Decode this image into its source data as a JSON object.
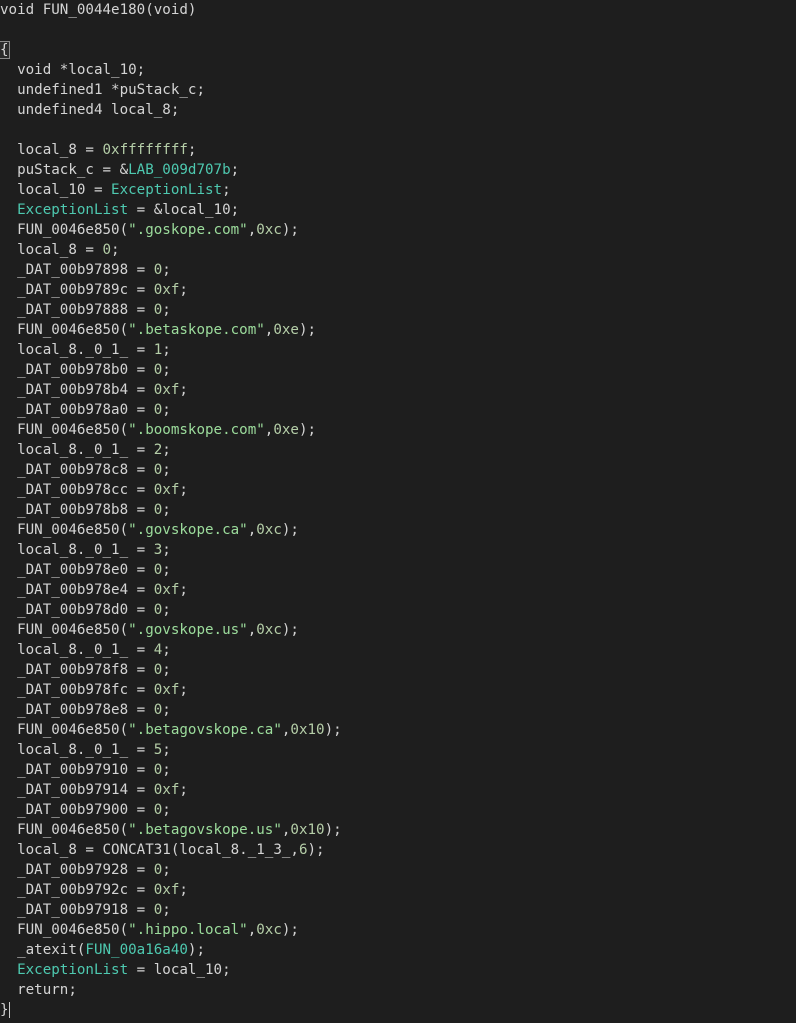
{
  "signature": "void FUN_0044e180(void)",
  "lines": [
    [
      [
        "fn",
        "void FUN_0044e180(void)"
      ]
    ],
    [],
    [
      [
        "cursor-brace",
        "{"
      ]
    ],
    [
      [
        "txt",
        "  void *local_10;"
      ]
    ],
    [
      [
        "txt",
        "  undefined1 *puStack_c;"
      ]
    ],
    [
      [
        "txt",
        "  undefined4 local_8;"
      ]
    ],
    [],
    [
      [
        "txt",
        "  local_8 = "
      ],
      [
        "num",
        "0xffffffff"
      ],
      [
        "txt",
        ";"
      ]
    ],
    [
      [
        "txt",
        "  puStack_c = &"
      ],
      [
        "lab",
        "LAB_009d707b"
      ],
      [
        "txt",
        ";"
      ]
    ],
    [
      [
        "txt",
        "  local_10 = "
      ],
      [
        "glob",
        "ExceptionList"
      ],
      [
        "txt",
        ";"
      ]
    ],
    [
      [
        "txt",
        "  "
      ],
      [
        "glob",
        "ExceptionList"
      ],
      [
        "txt",
        " = &local_10;"
      ]
    ],
    [
      [
        "txt",
        "  FUN_0046e850("
      ],
      [
        "str",
        "\".goskope.com\""
      ],
      [
        "txt",
        ","
      ],
      [
        "num",
        "0xc"
      ],
      [
        "txt",
        ");"
      ]
    ],
    [
      [
        "txt",
        "  local_8 = "
      ],
      [
        "num",
        "0"
      ],
      [
        "txt",
        ";"
      ]
    ],
    [
      [
        "txt",
        "  _DAT_00b97898 = "
      ],
      [
        "num",
        "0"
      ],
      [
        "txt",
        ";"
      ]
    ],
    [
      [
        "txt",
        "  _DAT_00b9789c = "
      ],
      [
        "num",
        "0xf"
      ],
      [
        "txt",
        ";"
      ]
    ],
    [
      [
        "txt",
        "  _DAT_00b97888 = "
      ],
      [
        "num",
        "0"
      ],
      [
        "txt",
        ";"
      ]
    ],
    [
      [
        "txt",
        "  FUN_0046e850("
      ],
      [
        "str",
        "\".betaskope.com\""
      ],
      [
        "txt",
        ","
      ],
      [
        "num",
        "0xe"
      ],
      [
        "txt",
        ");"
      ]
    ],
    [
      [
        "txt",
        "  local_8._0_1_ = "
      ],
      [
        "num",
        "1"
      ],
      [
        "txt",
        ";"
      ]
    ],
    [
      [
        "txt",
        "  _DAT_00b978b0 = "
      ],
      [
        "num",
        "0"
      ],
      [
        "txt",
        ";"
      ]
    ],
    [
      [
        "txt",
        "  _DAT_00b978b4 = "
      ],
      [
        "num",
        "0xf"
      ],
      [
        "txt",
        ";"
      ]
    ],
    [
      [
        "txt",
        "  _DAT_00b978a0 = "
      ],
      [
        "num",
        "0"
      ],
      [
        "txt",
        ";"
      ]
    ],
    [
      [
        "txt",
        "  FUN_0046e850("
      ],
      [
        "str",
        "\".boomskope.com\""
      ],
      [
        "txt",
        ","
      ],
      [
        "num",
        "0xe"
      ],
      [
        "txt",
        ");"
      ]
    ],
    [
      [
        "txt",
        "  local_8._0_1_ = "
      ],
      [
        "num",
        "2"
      ],
      [
        "txt",
        ";"
      ]
    ],
    [
      [
        "txt",
        "  _DAT_00b978c8 = "
      ],
      [
        "num",
        "0"
      ],
      [
        "txt",
        ";"
      ]
    ],
    [
      [
        "txt",
        "  _DAT_00b978cc = "
      ],
      [
        "num",
        "0xf"
      ],
      [
        "txt",
        ";"
      ]
    ],
    [
      [
        "txt",
        "  _DAT_00b978b8 = "
      ],
      [
        "num",
        "0"
      ],
      [
        "txt",
        ";"
      ]
    ],
    [
      [
        "txt",
        "  FUN_0046e850("
      ],
      [
        "str",
        "\".govskope.ca\""
      ],
      [
        "txt",
        ","
      ],
      [
        "num",
        "0xc"
      ],
      [
        "txt",
        ");"
      ]
    ],
    [
      [
        "txt",
        "  local_8._0_1_ = "
      ],
      [
        "num",
        "3"
      ],
      [
        "txt",
        ";"
      ]
    ],
    [
      [
        "txt",
        "  _DAT_00b978e0 = "
      ],
      [
        "num",
        "0"
      ],
      [
        "txt",
        ";"
      ]
    ],
    [
      [
        "txt",
        "  _DAT_00b978e4 = "
      ],
      [
        "num",
        "0xf"
      ],
      [
        "txt",
        ";"
      ]
    ],
    [
      [
        "txt",
        "  _DAT_00b978d0 = "
      ],
      [
        "num",
        "0"
      ],
      [
        "txt",
        ";"
      ]
    ],
    [
      [
        "txt",
        "  FUN_0046e850("
      ],
      [
        "str",
        "\".govskope.us\""
      ],
      [
        "txt",
        ","
      ],
      [
        "num",
        "0xc"
      ],
      [
        "txt",
        ");"
      ]
    ],
    [
      [
        "txt",
        "  local_8._0_1_ = "
      ],
      [
        "num",
        "4"
      ],
      [
        "txt",
        ";"
      ]
    ],
    [
      [
        "txt",
        "  _DAT_00b978f8 = "
      ],
      [
        "num",
        "0"
      ],
      [
        "txt",
        ";"
      ]
    ],
    [
      [
        "txt",
        "  _DAT_00b978fc = "
      ],
      [
        "num",
        "0xf"
      ],
      [
        "txt",
        ";"
      ]
    ],
    [
      [
        "txt",
        "  _DAT_00b978e8 = "
      ],
      [
        "num",
        "0"
      ],
      [
        "txt",
        ";"
      ]
    ],
    [
      [
        "txt",
        "  FUN_0046e850("
      ],
      [
        "str",
        "\".betagovskope.ca\""
      ],
      [
        "txt",
        ","
      ],
      [
        "num",
        "0x10"
      ],
      [
        "txt",
        ");"
      ]
    ],
    [
      [
        "txt",
        "  local_8._0_1_ = "
      ],
      [
        "num",
        "5"
      ],
      [
        "txt",
        ";"
      ]
    ],
    [
      [
        "txt",
        "  _DAT_00b97910 = "
      ],
      [
        "num",
        "0"
      ],
      [
        "txt",
        ";"
      ]
    ],
    [
      [
        "txt",
        "  _DAT_00b97914 = "
      ],
      [
        "num",
        "0xf"
      ],
      [
        "txt",
        ";"
      ]
    ],
    [
      [
        "txt",
        "  _DAT_00b97900 = "
      ],
      [
        "num",
        "0"
      ],
      [
        "txt",
        ";"
      ]
    ],
    [
      [
        "txt",
        "  FUN_0046e850("
      ],
      [
        "str",
        "\".betagovskope.us\""
      ],
      [
        "txt",
        ","
      ],
      [
        "num",
        "0x10"
      ],
      [
        "txt",
        ");"
      ]
    ],
    [
      [
        "txt",
        "  local_8 = CONCAT31(local_8._1_3_,"
      ],
      [
        "num",
        "6"
      ],
      [
        "txt",
        ");"
      ]
    ],
    [
      [
        "txt",
        "  _DAT_00b97928 = "
      ],
      [
        "num",
        "0"
      ],
      [
        "txt",
        ";"
      ]
    ],
    [
      [
        "txt",
        "  _DAT_00b9792c = "
      ],
      [
        "num",
        "0xf"
      ],
      [
        "txt",
        ";"
      ]
    ],
    [
      [
        "txt",
        "  _DAT_00b97918 = "
      ],
      [
        "num",
        "0"
      ],
      [
        "txt",
        ";"
      ]
    ],
    [
      [
        "txt",
        "  FUN_0046e850("
      ],
      [
        "str",
        "\".hippo.local\""
      ],
      [
        "txt",
        ","
      ],
      [
        "num",
        "0xc"
      ],
      [
        "txt",
        ");"
      ]
    ],
    [
      [
        "txt",
        "  _atexit("
      ],
      [
        "lab",
        "FUN_00a16a40"
      ],
      [
        "txt",
        ");"
      ]
    ],
    [
      [
        "txt",
        "  "
      ],
      [
        "glob",
        "ExceptionList"
      ],
      [
        "txt",
        " = local_10;"
      ]
    ],
    [
      [
        "txt",
        "  return;"
      ]
    ],
    [
      [
        "cursor-end",
        "}"
      ]
    ]
  ],
  "colors": {
    "background": "#1e1e1e",
    "text": "#d4d4d4",
    "number": "#b5cea8",
    "string": "#9cdc9c",
    "label": "#4ec9b0"
  }
}
